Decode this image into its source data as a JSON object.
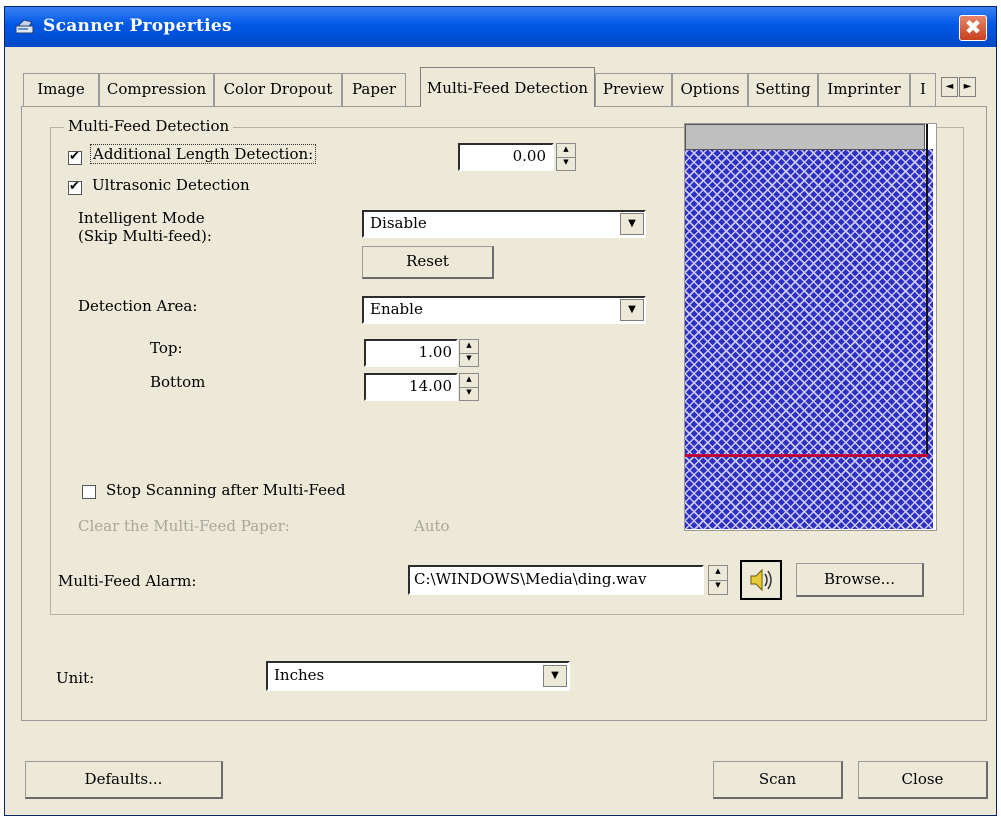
{
  "window": {
    "title": "Scanner Properties",
    "close_glyph": "✖"
  },
  "tabs": [
    {
      "label": "Image"
    },
    {
      "label": "Compression"
    },
    {
      "label": "Color Dropout"
    },
    {
      "label": "Paper"
    },
    {
      "label": "Multi-Feed Detection",
      "active": true
    },
    {
      "label": "Preview"
    },
    {
      "label": "Options"
    },
    {
      "label": "Setting"
    },
    {
      "label": "Imprinter"
    },
    {
      "label": "I"
    }
  ],
  "tab_scroll": {
    "left_glyph": "◄",
    "right_glyph": "►"
  },
  "group": {
    "title": "Multi-Feed Detection",
    "additional_length": {
      "label": "Additional Length Detection:",
      "checked": true,
      "value": "0.00"
    },
    "ultrasonic": {
      "label": "Ultrasonic Detection",
      "checked": true
    },
    "intelligent_mode": {
      "label_line1": "Intelligent Mode",
      "label_line2": "(Skip Multi-feed):",
      "value": "Disable"
    },
    "reset_label": "Reset",
    "detection_area": {
      "label": "Detection Area:",
      "value": "Enable"
    },
    "top": {
      "label": "Top:",
      "value": "1.00"
    },
    "bottom": {
      "label": "Bottom",
      "value": "14.00"
    },
    "stop_scanning": {
      "label": "Stop Scanning after Multi-Feed",
      "checked": false
    },
    "clear_paper": {
      "label": "Clear the Multi-Feed Paper:",
      "value": "Auto"
    },
    "alarm": {
      "label": "Multi-Feed Alarm:",
      "path": "C:\\WINDOWS\\Media\\ding.wav",
      "browse_label": "Browse..."
    }
  },
  "unit": {
    "label": "Unit:",
    "value": "Inches"
  },
  "footer": {
    "defaults_label": "Defaults...",
    "scan_label": "Scan",
    "close_label": "Close"
  },
  "glyphs": {
    "spin_up": "▲",
    "spin_down": "▼",
    "combo": "▼",
    "speaker": "speaker-icon"
  },
  "colors": {
    "title_bar": "#0058e6",
    "window_bg": "#ece9d8",
    "preview_fill": "#2f2fc4",
    "preview_line": "#c0003a"
  }
}
